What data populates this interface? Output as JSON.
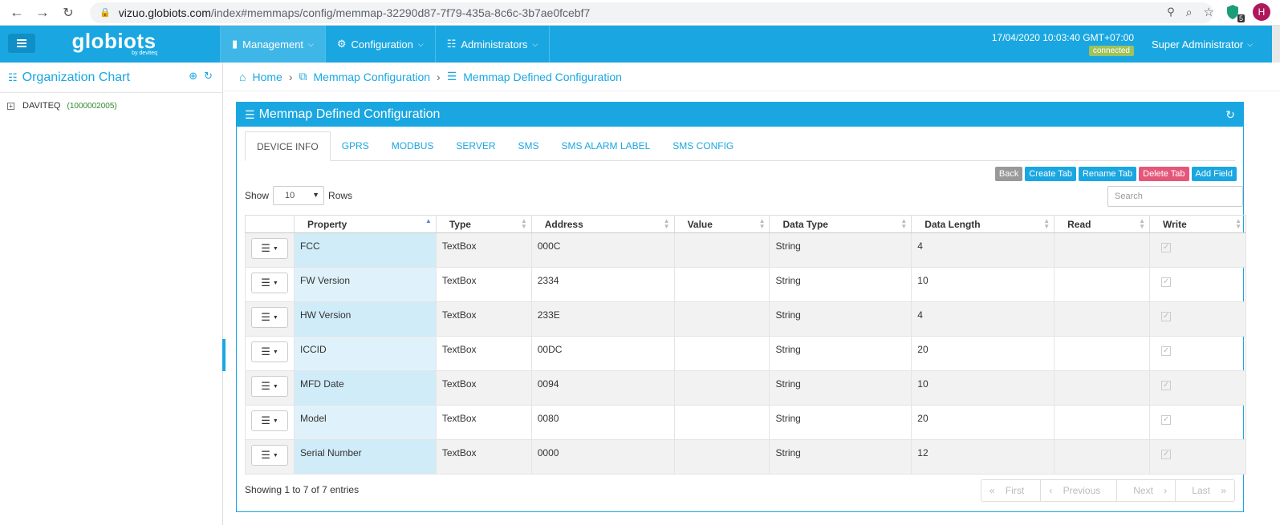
{
  "browser": {
    "url_domain": "vizuo.globiots.com",
    "url_path": "/index#memmaps/config/memmap-32290d87-7f79-435a-8c6c-3b7ae0fcebf7",
    "ext_count": "5",
    "profile_initial": "H"
  },
  "header": {
    "logo_text": "globiots",
    "logo_sub": "by deviteq",
    "nav": [
      {
        "label": "Management",
        "icon": "battery-icon"
      },
      {
        "label": "Configuration",
        "icon": "cogs-icon"
      },
      {
        "label": "Administrators",
        "icon": "sitemap-icon"
      }
    ],
    "datetime": "17/04/2020 10:03:40 GMT+07:00",
    "status": "connected",
    "user": "Super Administrator",
    "accent": "#1aa7e1"
  },
  "sidebar": {
    "title": "Organization Chart",
    "tree": [
      {
        "label": "DAVITEQ",
        "code": "(1000002005)"
      }
    ]
  },
  "breadcrumb": {
    "home": "Home",
    "level1": "Memmap Configuration",
    "level2": "Memmap Defined Configuration"
  },
  "panel": {
    "title": "Memmap Defined Configuration",
    "tabs": [
      "DEVICE INFO",
      "GPRS",
      "MODBUS",
      "SERVER",
      "SMS",
      "SMS ALARM LABEL",
      "SMS CONFIG"
    ],
    "actions": {
      "back": "Back",
      "create": "Create Tab",
      "rename": "Rename Tab",
      "delete": "Delete Tab",
      "add": "Add Field"
    },
    "show_label": "Show",
    "rows_value": "10",
    "rows_label": "Rows",
    "search_placeholder": "Search",
    "columns": [
      "Property",
      "Type",
      "Address",
      "Value",
      "Data Type",
      "Data Length",
      "Read",
      "Write"
    ],
    "rows": [
      {
        "property": "FCC",
        "type": "TextBox",
        "address": "000C",
        "value": "",
        "data_type": "String",
        "length": "4"
      },
      {
        "property": "FW Version",
        "type": "TextBox",
        "address": "2334",
        "value": "",
        "data_type": "String",
        "length": "10"
      },
      {
        "property": "HW Version",
        "type": "TextBox",
        "address": "233E",
        "value": "",
        "data_type": "String",
        "length": "4"
      },
      {
        "property": "ICCID",
        "type": "TextBox",
        "address": "00DC",
        "value": "",
        "data_type": "String",
        "length": "20"
      },
      {
        "property": "MFD Date",
        "type": "TextBox",
        "address": "0094",
        "value": "",
        "data_type": "String",
        "length": "10"
      },
      {
        "property": "Model",
        "type": "TextBox",
        "address": "0080",
        "value": "",
        "data_type": "String",
        "length": "20"
      },
      {
        "property": "Serial Number",
        "type": "TextBox",
        "address": "0000",
        "value": "",
        "data_type": "String",
        "length": "12"
      }
    ],
    "footer": "Showing 1 to 7 of 7 entries",
    "pager": {
      "first": "First",
      "previous": "Previous",
      "next": "Next",
      "last": "Last"
    }
  }
}
